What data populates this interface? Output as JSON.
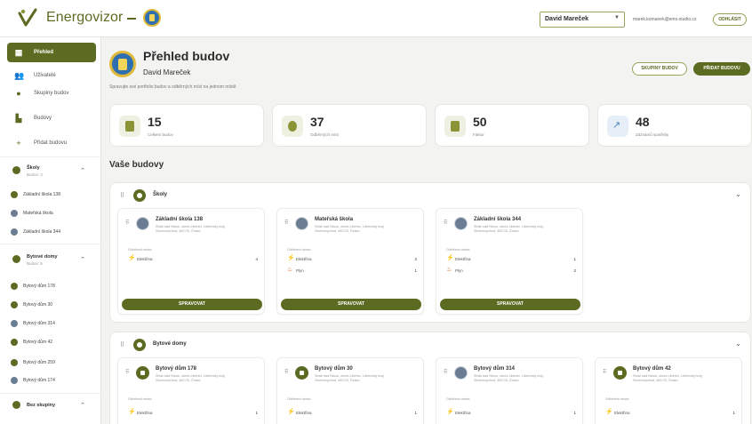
{
  "header": {
    "app_name": "Energovizor",
    "user_selected": "David Mareček",
    "user_email": "marek.komanek@ems-studio.cz",
    "logout_label": "ODHLÁSIT"
  },
  "sidebar": {
    "nav": [
      {
        "label": "Přehled",
        "icon": "dashboard-icon"
      },
      {
        "label": "Uživatelé",
        "icon": "users-icon"
      },
      {
        "label": "Skupiny budov",
        "icon": "groups-icon"
      },
      {
        "label": "Budovy",
        "icon": "building-icon"
      },
      {
        "label": "Přidat budovu",
        "icon": "plus-icon"
      }
    ],
    "groups": [
      {
        "name": "Školy",
        "count": "Budov: 3",
        "buildings": [
          "Základní škola 138",
          "Mateřská škola",
          "Základní škola 344"
        ]
      },
      {
        "name": "Bytové domy",
        "count": "Budov: 6",
        "buildings": [
          "Bytový dům 178",
          "Bytový dům 30",
          "Bytový dům 314",
          "Bytový dům 42",
          "Bytový dům 259",
          "Bytový dům 174"
        ]
      },
      {
        "name": "Bez skupiny"
      }
    ]
  },
  "page": {
    "title": "Přehled budov",
    "owner": "David Mareček",
    "subtitle": "Spravujte své portfolio budov a odběrných míst na jednom místě",
    "btn_groups": "SKUPINY BUDOV",
    "btn_add": "PŘIDAT BUDOVU"
  },
  "stats": [
    {
      "value": "15",
      "label": "Celkem budov"
    },
    {
      "value": "37",
      "label": "Odběrných míst"
    },
    {
      "value": "50",
      "label": "Faktur"
    },
    {
      "value": "48",
      "label": "Záznamů spotřeby"
    }
  ],
  "section_title": "Vaše budovy",
  "groups": [
    {
      "name": "Školy",
      "buildings": [
        {
          "name": "Základní škola 138",
          "addr1": "Stráž nad Nisou, okres Liberec, Liberecký kraj,",
          "addr2": "Severovýchod, 463 03, Česko",
          "meters_label": "Odběrná místa",
          "meters": [
            {
              "type": "Elektřina",
              "count": "4"
            }
          ],
          "manage": "SPRAVOVAT"
        },
        {
          "name": "Mateřská škola",
          "addr1": "Stráž nad Nisou, okres Liberec, Liberecký kraj,",
          "addr2": "Severovýchod, 463 03, Česko",
          "meters_label": "Odběrná místa",
          "meters": [
            {
              "type": "Elektřina",
              "count": "2"
            },
            {
              "type": "Plyn",
              "count": "1"
            }
          ],
          "manage": "SPRAVOVAT"
        },
        {
          "name": "Základní škola 344",
          "addr1": "Stráž nad Nisou, okres Liberec, Liberecký kraj,",
          "addr2": "Severovýchod, 463 03, Česko",
          "meters_label": "Odběrná místa",
          "meters": [
            {
              "type": "Elektřina",
              "count": "1"
            },
            {
              "type": "Plyn",
              "count": "2"
            }
          ],
          "manage": "SPRAVOVAT"
        }
      ]
    },
    {
      "name": "Bytové domy",
      "buildings": [
        {
          "name": "Bytový dům 178",
          "addr1": "Stráž nad Nisou, okres Liberec, Liberecký kraj,",
          "addr2": "Severovýchod, 463 03, Česko",
          "meters_label": "Odběrná místa",
          "meters": [
            {
              "type": "Elektřina",
              "count": "1"
            }
          ]
        },
        {
          "name": "Bytový dům 30",
          "addr1": "Stráž nad Nisou, okres Liberec, Liberecký kraj,",
          "addr2": "Severovýchod, 463 03, Česko",
          "meters_label": "Odběrná místa",
          "meters": [
            {
              "type": "Elektřina",
              "count": "1"
            }
          ]
        },
        {
          "name": "Bytový dům 314",
          "addr1": "Stráž nad Nisou, okres Liberec, Liberecký kraj,",
          "addr2": "Severovýchod, 463 03, Česko",
          "meters_label": "Odběrná místa",
          "meters": [
            {
              "type": "Elektřina",
              "count": "1"
            }
          ]
        },
        {
          "name": "Bytový dům 42",
          "addr1": "Stráž nad Nisou, okres Liberec, Liberecký kraj,",
          "addr2": "Severovýchod, 463 03, Česko",
          "meters_label": "Odběrná místa",
          "meters": [
            {
              "type": "Elektřina",
              "count": "1"
            }
          ]
        }
      ]
    }
  ],
  "colors": {
    "brand": "#5c6b22",
    "brand_light": "#8a9436",
    "electricity": "#e5a913",
    "gas": "#e0552c"
  }
}
